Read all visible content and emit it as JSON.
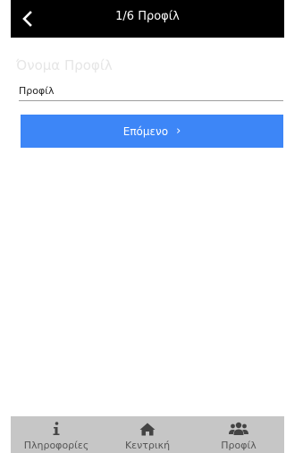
{
  "header": {
    "title": "1/6 Προφίλ",
    "back_icon": "chevron-left-icon"
  },
  "form": {
    "faded_label": "Όνομα Προφίλ",
    "profile_name_value": "Προφίλ",
    "next_label": "Επόμενο",
    "next_chevron": "›"
  },
  "bottom_nav": {
    "items": [
      {
        "label": "Πληροφορίες",
        "icon": "info-icon"
      },
      {
        "label": "Κεντρική",
        "icon": "home-icon"
      },
      {
        "label": "Προφίλ",
        "icon": "users-icon"
      }
    ]
  },
  "colors": {
    "header_bg": "#000000",
    "button_bg": "#3d86f7",
    "bottom_bar_bg": "#c6c6c6",
    "label_faded": "#e6e6e6"
  }
}
